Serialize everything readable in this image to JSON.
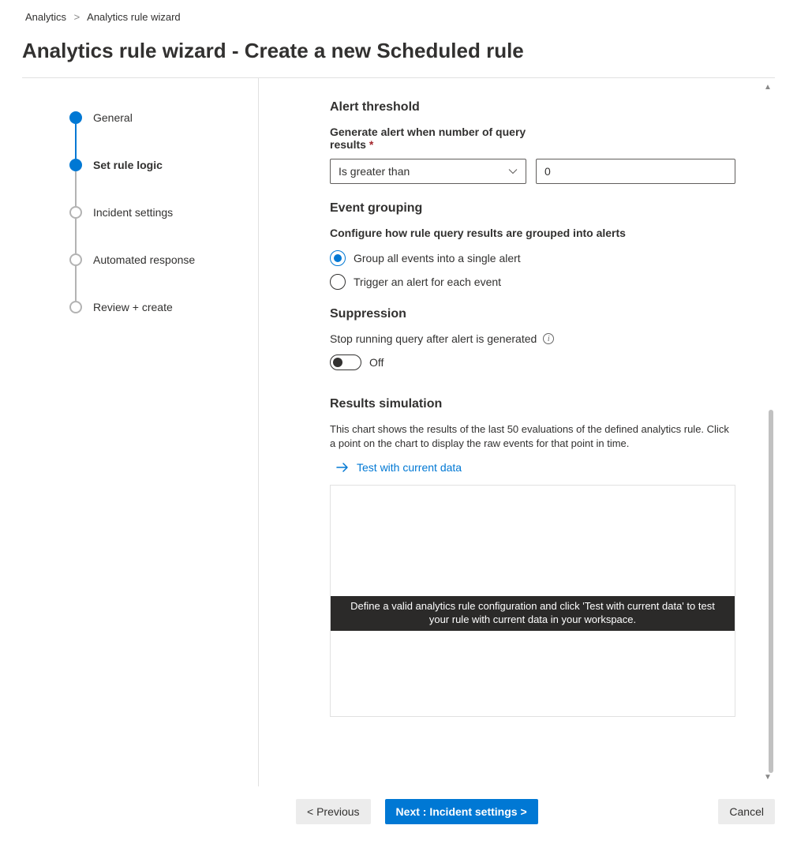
{
  "breadcrumb": {
    "root": "Analytics",
    "current": "Analytics rule wizard"
  },
  "title": "Analytics rule wizard - Create a new Scheduled rule",
  "steps": [
    {
      "label": "General"
    },
    {
      "label": "Set rule logic"
    },
    {
      "label": "Incident settings"
    },
    {
      "label": "Automated response"
    },
    {
      "label": "Review + create"
    }
  ],
  "threshold": {
    "heading": "Alert threshold",
    "label": "Generate alert when number of query results",
    "operator": "Is greater than",
    "value": "0"
  },
  "grouping": {
    "heading": "Event grouping",
    "subheading": "Configure how rule query results are grouped into alerts",
    "opt_single": "Group all events into a single alert",
    "opt_each": "Trigger an alert for each event"
  },
  "suppression": {
    "heading": "Suppression",
    "label": "Stop running query after alert is generated",
    "state": "Off"
  },
  "results": {
    "heading": "Results simulation",
    "desc": "This chart shows the results of the last 50 evaluations of the defined analytics rule. Click a point on the chart to display the raw events for that point in time.",
    "test_link": "Test with current data",
    "empty_msg": "Define a valid analytics rule configuration and click 'Test with current data' to test your rule with current data in your workspace."
  },
  "footer": {
    "prev": "< Previous",
    "next": "Next : Incident settings >",
    "cancel": "Cancel"
  }
}
